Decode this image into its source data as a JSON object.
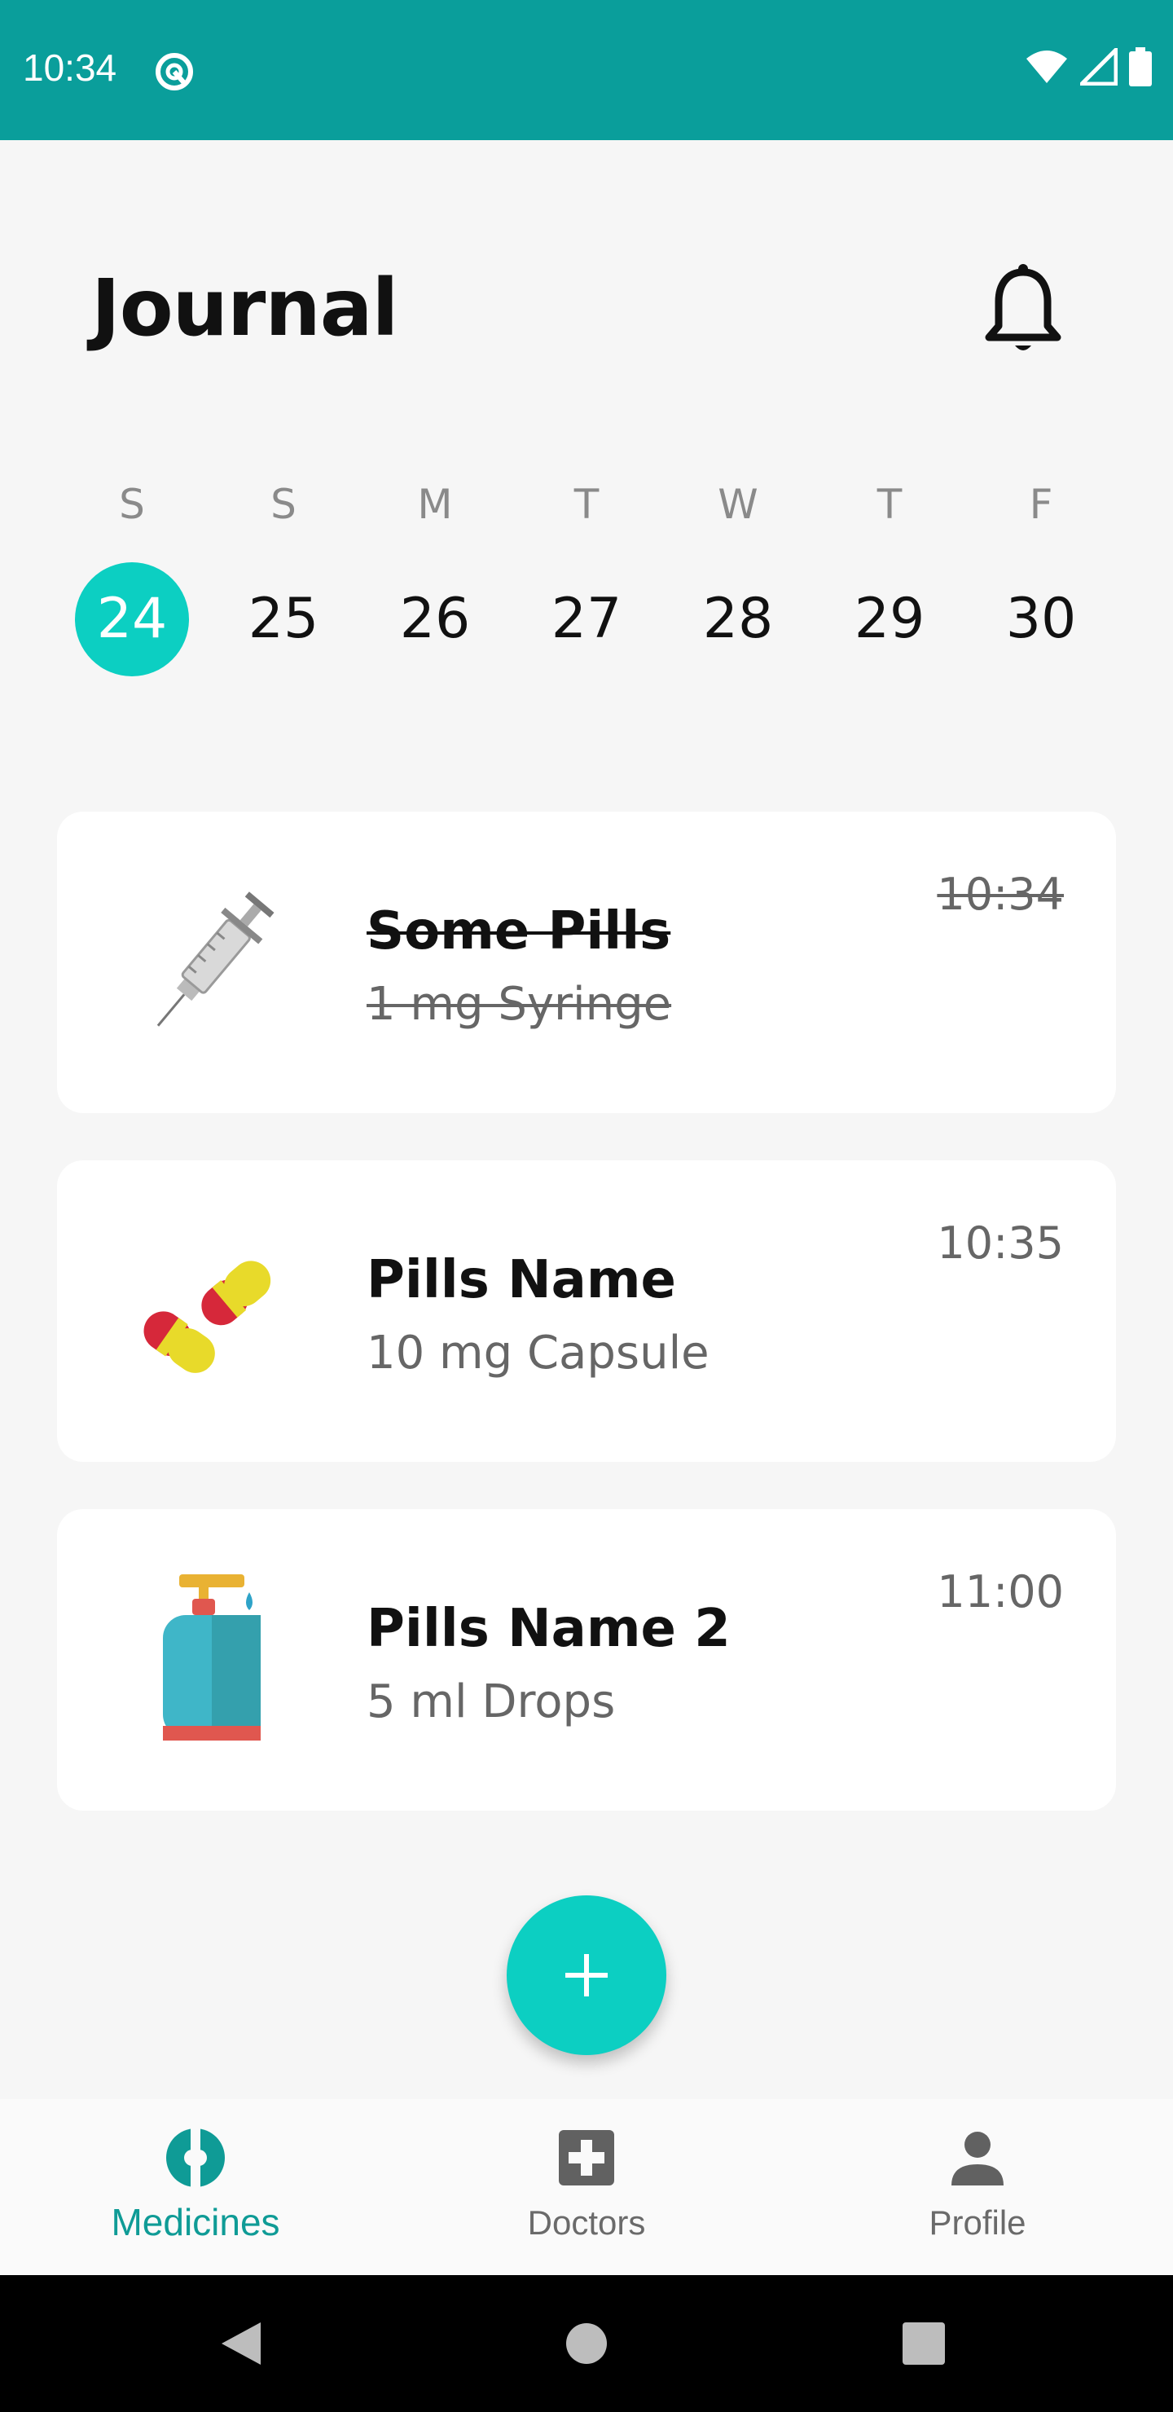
{
  "status_bar": {
    "time": "10:34",
    "icons": [
      "app-icon",
      "wifi-icon",
      "signal-icon",
      "battery-icon"
    ]
  },
  "header": {
    "title": "Journal",
    "notification_icon": "bell-icon"
  },
  "week": {
    "days": [
      {
        "label": "S",
        "date": "24",
        "selected": true
      },
      {
        "label": "S",
        "date": "25",
        "selected": false
      },
      {
        "label": "M",
        "date": "26",
        "selected": false
      },
      {
        "label": "T",
        "date": "27",
        "selected": false
      },
      {
        "label": "W",
        "date": "28",
        "selected": false
      },
      {
        "label": "T",
        "date": "29",
        "selected": false
      },
      {
        "label": "F",
        "date": "30",
        "selected": false
      }
    ]
  },
  "medicines": [
    {
      "name": "Some Pills",
      "dose": "1 mg Syringe",
      "time": "10:34",
      "taken": true,
      "icon": "syringe-icon"
    },
    {
      "name": "Pills Name",
      "dose": "10 mg Capsule",
      "time": "10:35",
      "taken": false,
      "icon": "capsule-icon"
    },
    {
      "name": "Pills Name 2",
      "dose": "5 ml Drops",
      "time": "11:00",
      "taken": false,
      "icon": "drops-bottle-icon"
    }
  ],
  "fab": {
    "icon": "plus-icon"
  },
  "bottom_nav": {
    "items": [
      {
        "label": "Medicines",
        "icon": "medicine-icon",
        "active": true
      },
      {
        "label": "Doctors",
        "icon": "medical-cross-icon",
        "active": false
      },
      {
        "label": "Profile",
        "icon": "person-icon",
        "active": false
      }
    ]
  },
  "colors": {
    "status_bar": "#0a9e9b",
    "accent": "#0ccfc2",
    "active_nav": "#0f9b96"
  }
}
